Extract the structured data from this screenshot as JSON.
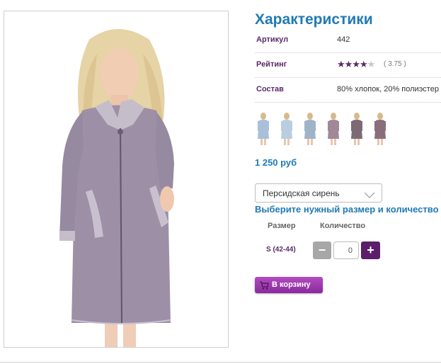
{
  "product": {
    "image_alt": "Женщина в халате цвета персидская сирень"
  },
  "specs": {
    "title": "Характеристики",
    "article_label": "Артикул",
    "article_value": "442",
    "rating_label": "Рейтинг",
    "rating_stars": 4,
    "rating_max": 5,
    "rating_value": "( 3.75 )",
    "material_label": "Состав",
    "material_value": "80% хлопок, 20% полиэстер"
  },
  "thumbnails": [
    {
      "name": "thumb-1",
      "color": "#a9c0d8"
    },
    {
      "name": "thumb-2",
      "color": "#b9cde0"
    },
    {
      "name": "thumb-3",
      "color": "#9fb4c8"
    },
    {
      "name": "thumb-4",
      "color": "#a08898"
    },
    {
      "name": "thumb-5",
      "color": "#7e6a74"
    },
    {
      "name": "thumb-6",
      "color": "#8a6e7c"
    }
  ],
  "price": "1 250 руб",
  "color_select": {
    "selected": "Персидская сирень"
  },
  "size_section": {
    "heading": "Выберите нужный размер и количество",
    "size_col": "Размер",
    "qty_col": "Количество",
    "size_value": "S (42-44)",
    "minus_label": "−",
    "plus_label": "+",
    "quantity": "0"
  },
  "cart": {
    "label": "В корзину"
  },
  "colors": {
    "accent_blue": "#1f7ab4",
    "accent_purple": "#5a2a6a",
    "cart_button": "#9b35ae",
    "robe": "#9d90a6"
  }
}
